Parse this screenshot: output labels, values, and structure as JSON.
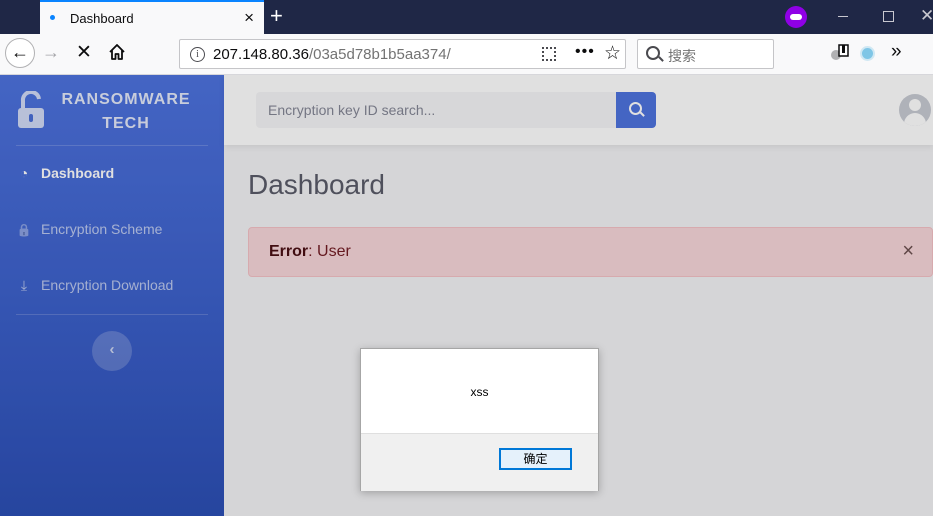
{
  "browser": {
    "tab_title": "Dashboard",
    "tab_close": "×",
    "new_tab": "+",
    "url_host": "207.148.80.36",
    "url_path": "/03a5d78b1b5aa374/",
    "search_placeholder": "搜索",
    "back_glyph": "←",
    "forward_glyph": "→",
    "stop_glyph": "✕",
    "more_glyph": "•••",
    "star_glyph": "☆",
    "overflow_glyph": "»",
    "info_glyph": "i",
    "window_close": "✕"
  },
  "sidebar": {
    "brand_line1": "RANSOMWARE",
    "brand_line2": "TECH",
    "items": [
      {
        "label": "Dashboard",
        "icon": "tachometer-icon",
        "glyph": "◔",
        "active": true
      },
      {
        "label": "Encryption Scheme",
        "icon": "lock-icon",
        "glyph": "🔒",
        "active": false
      },
      {
        "label": "Encryption Download",
        "icon": "download-icon",
        "glyph": "⤓",
        "active": false
      }
    ],
    "toggle_glyph": "‹"
  },
  "topbar": {
    "search_placeholder": "Encryption key ID search..."
  },
  "main": {
    "title": "Dashboard",
    "alert": {
      "strong": "Error",
      "text": ": User",
      "close": "×"
    }
  },
  "dialog": {
    "message": "xss",
    "ok_label": "确定"
  },
  "colors": {
    "accent": "#4e73df",
    "alert_bg": "#f8d7da",
    "alert_text": "#721c24",
    "tabbar": "#1f2746"
  }
}
